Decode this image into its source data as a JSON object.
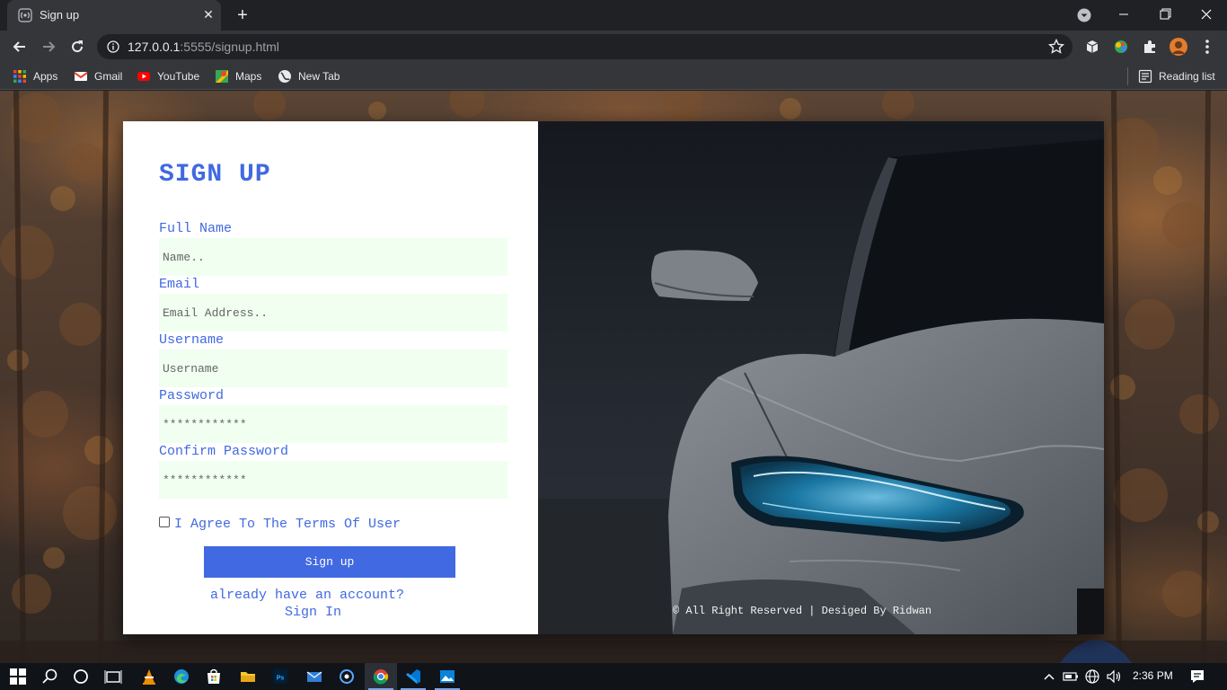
{
  "browser": {
    "tab_title": "Sign up",
    "url_host": "127.0.0.1",
    "url_rest": ":5555/signup.html",
    "bookmarks": [
      {
        "label": "Apps",
        "icon": "apps-grid-icon"
      },
      {
        "label": "Gmail",
        "icon": "gmail-icon"
      },
      {
        "label": "YouTube",
        "icon": "youtube-icon"
      },
      {
        "label": "Maps",
        "icon": "maps-icon"
      },
      {
        "label": "New Tab",
        "icon": "new-tab-globe-icon"
      }
    ],
    "reading_list": "Reading list"
  },
  "form": {
    "title": "SIGN UP",
    "full_name_label": "Full Name",
    "full_name_placeholder": "Name..",
    "email_label": "Email",
    "email_placeholder": "Email Address..",
    "username_label": "Username",
    "username_placeholder": "Username",
    "password_label": "Password",
    "password_value": "************",
    "confirm_label": "Confirm Password",
    "confirm_value": "************",
    "terms_text": "I Agree To The Terms Of User",
    "terms_checked": false,
    "submit_label": "Sign up",
    "already_text": "already have an account?",
    "signin_link": "Sign In"
  },
  "image_panel": {
    "copyright": "© All Right Reserved | Desiged By Ridwan"
  },
  "taskbar": {
    "time": "2:36 PM"
  },
  "colors": {
    "accent": "#4169e1",
    "input_bg": "#f0fff0"
  }
}
